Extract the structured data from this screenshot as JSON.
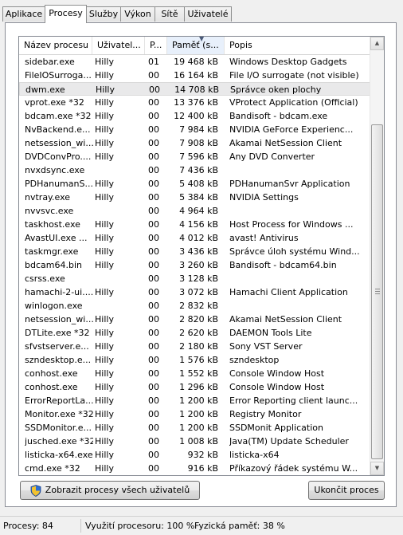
{
  "tabs": [
    "Aplikace",
    "Procesy",
    "Služby",
    "Výkon",
    "Sítě",
    "Uživatelé"
  ],
  "active_tab": 1,
  "columns": [
    "Název procesu",
    "Uživatel...",
    "P...",
    "Paměť (s...",
    "Popis"
  ],
  "processes": [
    [
      "sidebar.exe",
      "Hilly",
      "01",
      "19 468 kB",
      "Windows Desktop Gadgets"
    ],
    [
      "FileIOSurroga...",
      "Hilly",
      "00",
      "16 164 kB",
      "File I/O surrogate (not visible)"
    ],
    [
      "dwm.exe",
      "Hilly",
      "00",
      "14 708 kB",
      "Správce oken plochy"
    ],
    [
      "vprot.exe *32",
      "Hilly",
      "00",
      "13 376 kB",
      "VProtect Application (Official)"
    ],
    [
      "bdcam.exe *32",
      "Hilly",
      "00",
      "12 400 kB",
      "Bandisoft - bdcam.exe"
    ],
    [
      "NvBackend.e...",
      "Hilly",
      "00",
      "7 984 kB",
      "NVIDIA GeForce Experienc..."
    ],
    [
      "netsession_wi...",
      "Hilly",
      "00",
      "7 908 kB",
      "Akamai NetSession Client"
    ],
    [
      "DVDConvPro....",
      "Hilly",
      "00",
      "7 596 kB",
      "Any DVD Converter"
    ],
    [
      "nvxdsync.exe",
      "",
      "00",
      "7 436 kB",
      ""
    ],
    [
      "PDHanumanS...",
      "Hilly",
      "00",
      "5 408 kB",
      "PDHanumanSvr Application"
    ],
    [
      "nvtray.exe",
      "Hilly",
      "00",
      "5 384 kB",
      "NVIDIA Settings"
    ],
    [
      "nvvsvc.exe",
      "",
      "00",
      "4 964 kB",
      ""
    ],
    [
      "taskhost.exe",
      "Hilly",
      "00",
      "4 156 kB",
      "Host Process for Windows ..."
    ],
    [
      "AvastUI.exe ...",
      "Hilly",
      "00",
      "4 012 kB",
      "avast! Antivirus"
    ],
    [
      "taskmgr.exe",
      "Hilly",
      "00",
      "3 436 kB",
      "Správce úloh systému Wind..."
    ],
    [
      "bdcam64.bin",
      "Hilly",
      "00",
      "3 260 kB",
      "Bandisoft - bdcam64.bin"
    ],
    [
      "csrss.exe",
      "",
      "00",
      "3 128 kB",
      ""
    ],
    [
      "hamachi-2-ui....",
      "Hilly",
      "00",
      "3 072 kB",
      "Hamachi Client Application"
    ],
    [
      "winlogon.exe",
      "",
      "00",
      "2 832 kB",
      ""
    ],
    [
      "netsession_wi...",
      "Hilly",
      "00",
      "2 820 kB",
      "Akamai NetSession Client"
    ],
    [
      "DTLite.exe *32",
      "Hilly",
      "00",
      "2 620 kB",
      "DAEMON Tools Lite"
    ],
    [
      "sfvstserver.e...",
      "Hilly",
      "00",
      "2 180 kB",
      "Sony VST Server"
    ],
    [
      "szndesktop.e...",
      "Hilly",
      "00",
      "1 576 kB",
      "szndesktop"
    ],
    [
      "conhost.exe",
      "Hilly",
      "00",
      "1 552 kB",
      "Console Window Host"
    ],
    [
      "conhost.exe",
      "Hilly",
      "00",
      "1 296 kB",
      "Console Window Host"
    ],
    [
      "ErrorReportLa...",
      "Hilly",
      "00",
      "1 200 kB",
      "Error Reporting client launc..."
    ],
    [
      "Monitor.exe *32",
      "Hilly",
      "00",
      "1 200 kB",
      "Registry Monitor"
    ],
    [
      "SSDMonitor.e...",
      "Hilly",
      "00",
      "1 200 kB",
      "SSDMonit Application"
    ],
    [
      "jusched.exe *32",
      "Hilly",
      "00",
      "1 008 kB",
      "Java(TM) Update Scheduler"
    ],
    [
      "listicka-x64.exe",
      "Hilly",
      "00",
      "932 kB",
      "listicka-x64"
    ],
    [
      "cmd.exe *32",
      "Hilly",
      "00",
      "916 kB",
      "Příkazový řádek systému W..."
    ]
  ],
  "selected_row": 2,
  "buttons": {
    "show_all": "Zobrazit procesy všech uživatelů",
    "end_process": "Ukončit proces"
  },
  "status": {
    "processes": "Procesy: 84",
    "cpu": "Využití procesoru: 100 %",
    "memory": "Fyzická paměť: 38 %"
  }
}
